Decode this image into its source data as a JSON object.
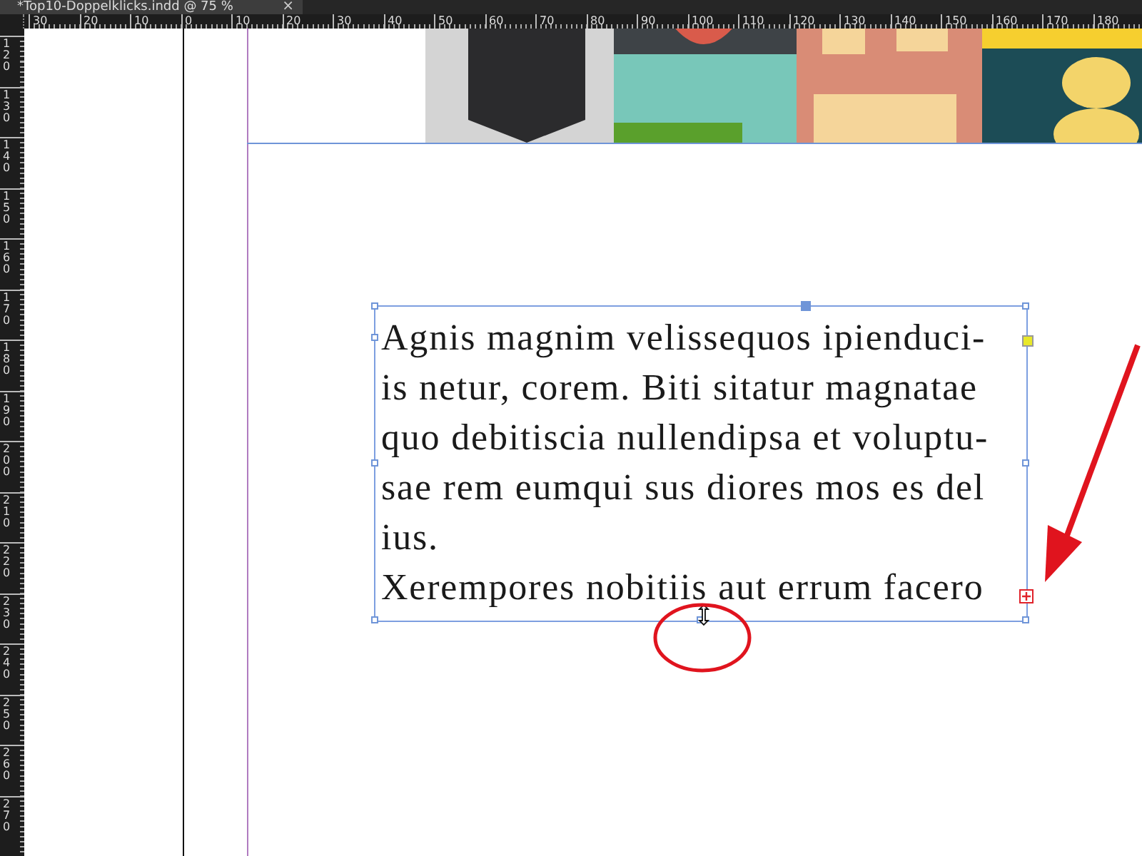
{
  "document_tab": {
    "title": "*Top10-Doppelklicks.indd @ 75 %",
    "close": "×"
  },
  "horizontal_ruler": {
    "labels": [
      "30",
      "20",
      "10",
      "0",
      "10",
      "20",
      "30",
      "40",
      "50",
      "60",
      "70",
      "80",
      "90",
      "100",
      "110",
      "120",
      "130",
      "140",
      "150",
      "160",
      "170",
      "180"
    ]
  },
  "vertical_ruler": {
    "labels": [
      "120",
      "130",
      "140",
      "150",
      "160",
      "170",
      "180",
      "190",
      "200",
      "210",
      "220",
      "230",
      "240",
      "250",
      "260",
      "270"
    ]
  },
  "text_frame": {
    "overset": true,
    "paragraphs": [
      {
        "lines": [
          "Agnis magnim velissequos ipienduci-",
          "is netur, corem. Biti sitatur magnatae",
          "quo debitiscia nullendipsa et voluptu-",
          "sae rem eumqui sus diores mos es del",
          "ius."
        ]
      },
      {
        "lines": [
          "Xerempores nobitiis aut errum facero"
        ]
      }
    ]
  }
}
